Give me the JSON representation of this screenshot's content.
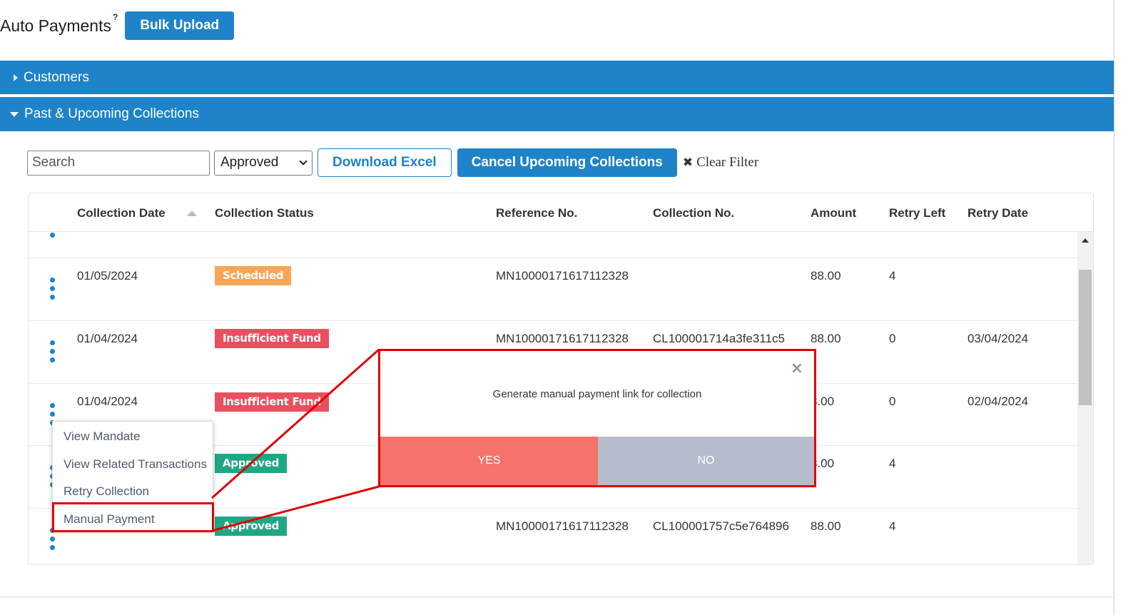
{
  "header": {
    "title": "Auto Payments",
    "help": "?",
    "bulk_upload_label": "Bulk Upload"
  },
  "accordions": {
    "customers": "Customers",
    "collections": "Past & Upcoming Collections"
  },
  "toolbar": {
    "search_placeholder": "Search",
    "status_selected": "Approved",
    "download_label": "Download Excel",
    "cancel_label": "Cancel Upcoming Collections",
    "clear_filter_label": "Clear Filter"
  },
  "table": {
    "columns": [
      "Collection Date",
      "Collection Status",
      "Reference No.",
      "Collection No.",
      "Amount",
      "Retry Left",
      "Retry Date"
    ],
    "rows": [
      {
        "date": "01/05/2024",
        "status": "Scheduled",
        "status_type": "scheduled",
        "ref": "MN10000171617112328",
        "coll": "",
        "amount": "88.00",
        "retry_left": "4",
        "retry_date": ""
      },
      {
        "date": "01/04/2024",
        "status": "Insufficient Fund",
        "status_type": "insufficient",
        "ref": "MN10000171617112328",
        "coll": "CL100001714a3fe311c5",
        "amount": "88.00",
        "retry_left": "0",
        "retry_date": "03/04/2024"
      },
      {
        "date": "01/04/2024",
        "status": "Insufficient Fund",
        "status_type": "insufficient",
        "ref": "",
        "coll": "",
        "amount": "8.00",
        "retry_left": "0",
        "retry_date": "02/04/2024"
      },
      {
        "date": "",
        "status": "Approved",
        "status_type": "approved",
        "ref": "",
        "coll": "",
        "amount": "8.00",
        "retry_left": "4",
        "retry_date": ""
      },
      {
        "date": "",
        "status": "Approved",
        "status_type": "approved",
        "ref": "MN10000171617112328",
        "coll": "CL100001757c5e764896",
        "amount": "88.00",
        "retry_left": "4",
        "retry_date": ""
      }
    ]
  },
  "context_menu": {
    "items": [
      "View Mandate",
      "View Related Transactions",
      "Retry Collection",
      "Manual Payment"
    ],
    "highlighted": "Manual Payment"
  },
  "modal": {
    "message": "Generate manual payment link for collection",
    "close": "×",
    "yes_label": "YES",
    "no_label": "NO"
  },
  "colors": {
    "primary": "#1e83c9",
    "scheduled": "#f7a556",
    "insufficient": "#e8505f",
    "approved": "#1fa784",
    "yes": "#f5736a",
    "no": "#b6bccb",
    "annotation": "#e00000"
  }
}
